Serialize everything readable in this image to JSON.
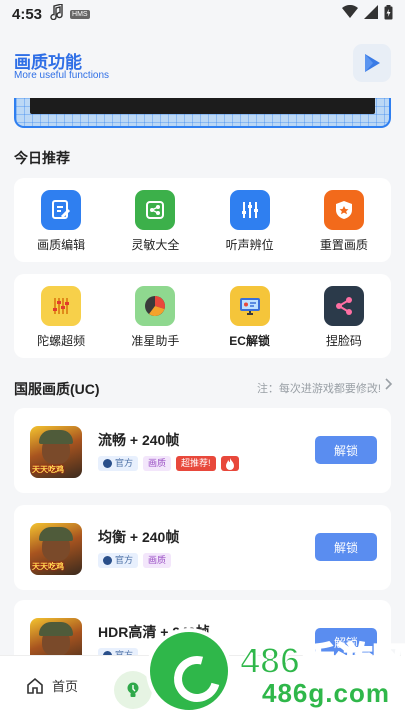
{
  "status_bar": {
    "time": "4:53",
    "badge": "HMS"
  },
  "header": {
    "title": "画质功能",
    "subtitle": "More useful functions"
  },
  "today": {
    "title": "今日推荐",
    "row1": [
      {
        "label": "画质编辑",
        "icon": "edit-icon",
        "color": "#2f7ff0"
      },
      {
        "label": "灵敏大全",
        "icon": "share-icon",
        "color": "#3cb04a"
      },
      {
        "label": "听声辨位",
        "icon": "equalizer-icon",
        "color": "#2f7ff0"
      },
      {
        "label": "重置画质",
        "icon": "shield-icon",
        "color": "#f26a1b"
      }
    ],
    "row2": [
      {
        "label": "陀螺超频",
        "icon": "sliders-icon",
        "color": "#f7d04a"
      },
      {
        "label": "准星助手",
        "icon": "pie-chart-icon",
        "color": "#8fd88f"
      },
      {
        "label": "EC解锁",
        "icon": "monitor-icon",
        "color": "#f5c53a"
      },
      {
        "label": "捏脸码",
        "icon": "share-nodes-icon",
        "color": "#2b3a4a"
      }
    ]
  },
  "presets": {
    "title": "国服画质(UC)",
    "hint": "注：每次进游戏都要修改!",
    "tag_official": "官方",
    "tag_quality": "画质",
    "tag_hot": "超推荐!",
    "unlock_label": "解锁",
    "game_brand": "天天吃鸡",
    "items": [
      {
        "name": "流畅 + 240帧"
      },
      {
        "name": "均衡 + 240帧"
      },
      {
        "name": "HDR高清 + 240帧"
      }
    ]
  },
  "nav": {
    "home": "首页"
  },
  "watermark": {
    "text": "486手游网",
    "url": "486g.com"
  }
}
